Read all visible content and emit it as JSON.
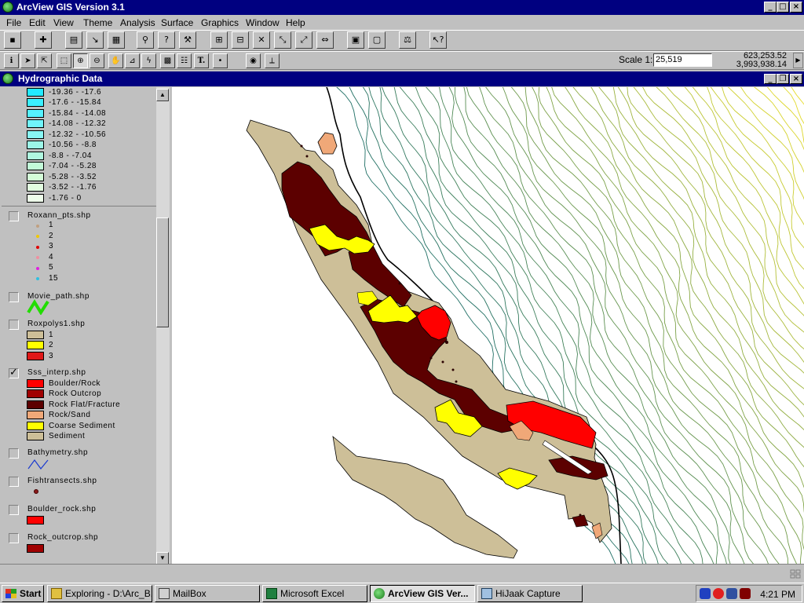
{
  "app": {
    "title": "ArcView GIS Version 3.1",
    "window_buttons": [
      "_",
      "□",
      "×"
    ]
  },
  "menu": [
    "File",
    "Edit",
    "View",
    "Theme",
    "Analysis",
    "Surface",
    "Graphics",
    "Window",
    "Help"
  ],
  "toolbar": {
    "scale_label": "Scale 1:",
    "scale_value": "25,519",
    "coord_x": "623,253.52",
    "coord_y": "3,993,938.14"
  },
  "view": {
    "title": "Hydrographic Data"
  },
  "legend": {
    "bathy_ranges": [
      {
        "label": "-19.36 - -17.6",
        "color": "#22eaff"
      },
      {
        "label": "-17.6 - -15.84",
        "color": "#3af0ff"
      },
      {
        "label": "-15.84 - -14.08",
        "color": "#55f2ff"
      },
      {
        "label": "-14.08 - -12.32",
        "color": "#70f4fb"
      },
      {
        "label": "-12.32 - -10.56",
        "color": "#88f6f4"
      },
      {
        "label": "-10.56 - -8.8",
        "color": "#9cf6e8"
      },
      {
        "label": "-8.8 - -7.04",
        "color": "#b0f8e0"
      },
      {
        "label": "-7.04 - -5.28",
        "color": "#c2fad8"
      },
      {
        "label": "-5.28 - -3.52",
        "color": "#d4fcd8"
      },
      {
        "label": "-3.52 - -1.76",
        "color": "#e2fce0"
      },
      {
        "label": "-1.76 - 0",
        "color": "#eefdea"
      }
    ],
    "roxann": {
      "name": "Roxann_pts.shp",
      "items": [
        {
          "label": "1",
          "color": "#c0a080"
        },
        {
          "label": "2",
          "color": "#f0c800"
        },
        {
          "label": "3",
          "color": "#e00000"
        },
        {
          "label": "4",
          "color": "#f090a0"
        },
        {
          "label": "5",
          "color": "#e020e0"
        },
        {
          "label": "15",
          "color": "#30c0e0"
        }
      ]
    },
    "movie_path": {
      "name": "Movie_path.shp"
    },
    "roxpolys": {
      "name": "Roxpolys1.shp",
      "items": [
        {
          "label": "1",
          "color": "#cdbf98"
        },
        {
          "label": "2",
          "color": "#ffff00"
        },
        {
          "label": "3",
          "color": "#e01818"
        }
      ]
    },
    "sss": {
      "name": "Sss_interp.shp",
      "items": [
        {
          "label": "Boulder/Rock",
          "color": "#ff0000"
        },
        {
          "label": "Rock Outcrop",
          "color": "#a00000"
        },
        {
          "label": "Rock Flat/Fracture",
          "color": "#5c0000"
        },
        {
          "label": "Rock/Sand",
          "color": "#f0a878"
        },
        {
          "label": "Coarse Sediment",
          "color": "#ffff00"
        },
        {
          "label": "Sediment",
          "color": "#cdbf98"
        }
      ]
    },
    "bathymetry": {
      "name": "Bathymetry.shp"
    },
    "fishtransects": {
      "name": "Fishtransects.shp"
    },
    "boulder_rock": {
      "name": "Boulder_rock.shp",
      "color": "#ff0000"
    },
    "rock_outcrop": {
      "name": "Rock_outcrop.shp",
      "color": "#a00000"
    }
  },
  "taskbar": {
    "start": "Start",
    "tasks": [
      "Exploring - D:\\Arc_B...",
      "MailBox",
      "Microsoft Excel",
      "ArcView GIS Ver...",
      "HiJaak Capture"
    ],
    "clock": "4:21 PM"
  }
}
